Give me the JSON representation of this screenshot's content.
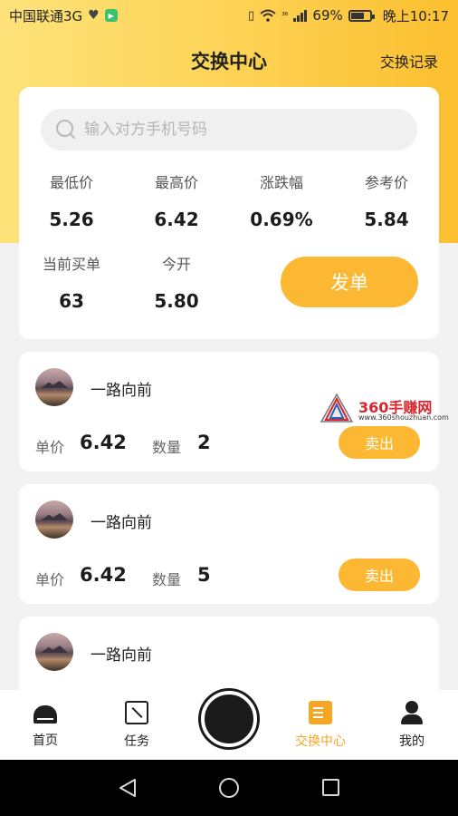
{
  "status_bar": {
    "carrier": "中国联通3G",
    "network_small": "³⁶",
    "battery": "69%",
    "time": "晚上10:17"
  },
  "header": {
    "title": "交换中心",
    "record_link": "交换记录"
  },
  "search": {
    "placeholder": "输入对方手机号码",
    "value": ""
  },
  "stats": [
    {
      "label": "最低价",
      "value": "5.26"
    },
    {
      "label": "最高价",
      "value": "6.42"
    },
    {
      "label": "涨跌幅",
      "value": "0.69%"
    },
    {
      "label": "参考价",
      "value": "5.84"
    },
    {
      "label": "当前买单",
      "value": "63"
    },
    {
      "label": "今开",
      "value": "5.80"
    }
  ],
  "order_button": "发单",
  "listings": [
    {
      "name": "一路向前",
      "price_label": "单价",
      "price": "6.42",
      "qty_label": "数量",
      "qty": "2",
      "action": "卖出"
    },
    {
      "name": "一路向前",
      "price_label": "单价",
      "price": "6.42",
      "qty_label": "数量",
      "qty": "5",
      "action": "卖出"
    },
    {
      "name": "一路向前"
    }
  ],
  "watermark": {
    "title": "360手赚网",
    "url": "www.360shouzhuan.com"
  },
  "tabbar": {
    "items": [
      {
        "label": "首页",
        "icon": "home-icon"
      },
      {
        "label": "任务",
        "icon": "task-icon"
      },
      {
        "label": "交换中心",
        "icon": "exchange-icon",
        "active": true
      },
      {
        "label": "我的",
        "icon": "profile-icon"
      }
    ]
  },
  "colors": {
    "accent": "#fcb733",
    "active_tab": "#f5a623",
    "header_gradient_start": "#fde27a",
    "header_gradient_end": "#fcbf2f"
  }
}
